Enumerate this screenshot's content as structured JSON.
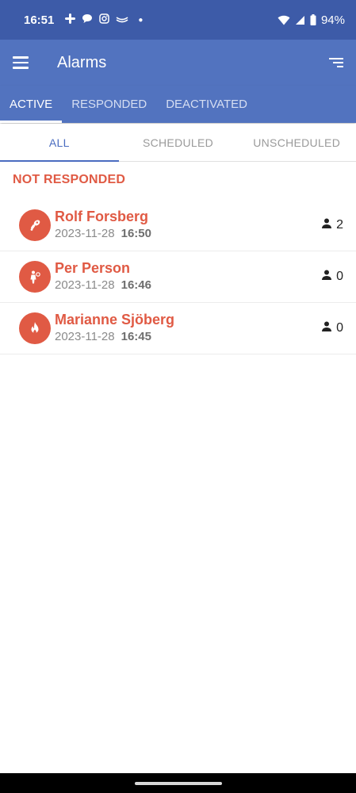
{
  "status_bar": {
    "time": "16:51",
    "battery": "94%",
    "left_icons": [
      "slack-icon",
      "chat-bubble-icon",
      "instagram-icon",
      "wave-icon",
      "dot-icon"
    ],
    "right_icons": [
      "wifi-icon",
      "signal-icon",
      "battery-icon"
    ]
  },
  "app_bar": {
    "title": "Alarms"
  },
  "main_tabs": [
    {
      "label": "ACTIVE",
      "active": true
    },
    {
      "label": "RESPONDED",
      "active": false
    },
    {
      "label": "DEACTIVATED",
      "active": false
    }
  ],
  "sub_tabs": [
    {
      "label": "ALL",
      "active": true
    },
    {
      "label": "SCHEDULED",
      "active": false
    },
    {
      "label": "UNSCHEDULED",
      "active": false
    }
  ],
  "section": {
    "title": "NOT RESPONDED"
  },
  "alarms": [
    {
      "name": "Rolf Forsberg",
      "date": "2023-11-28",
      "time": "16:50",
      "count": "2",
      "icon": "medical-alarm-icon"
    },
    {
      "name": "Per Person",
      "date": "2023-11-28",
      "time": "16:46",
      "count": "0",
      "icon": "person-assault-icon"
    },
    {
      "name": "Marianne Sjöberg",
      "date": "2023-11-28",
      "time": "16:45",
      "count": "0",
      "icon": "fire-icon"
    }
  ],
  "colors": {
    "status_bar": "#3d5ba8",
    "app_bar": "#5273bf",
    "accent": "#4a6cc0",
    "alarm_red": "#e05a44"
  }
}
